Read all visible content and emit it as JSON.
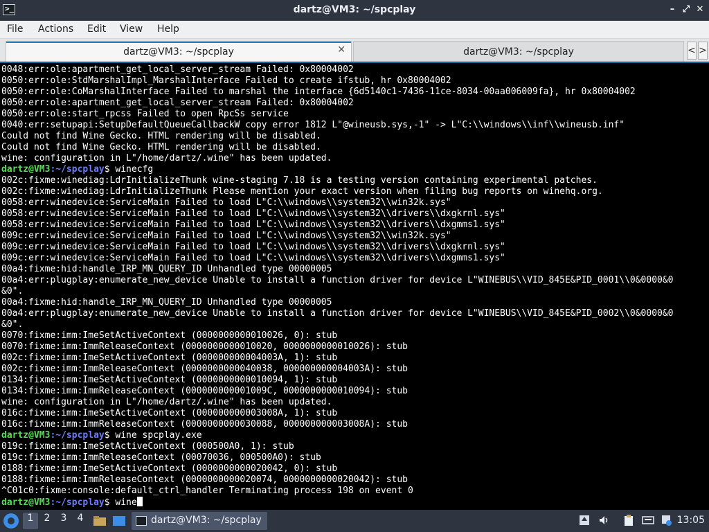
{
  "window": {
    "title": "dartz@VM3: ~/spcplay",
    "app_icon_glyph": ">_",
    "minimize_glyph": "–",
    "maximize_glyph": "⤢",
    "close_glyph": "✕"
  },
  "menu": [
    "File",
    "Actions",
    "Edit",
    "View",
    "Help"
  ],
  "tabs": [
    {
      "label": "dartz@VM3: ~/spcplay",
      "active": true,
      "close_glyph": "✕"
    },
    {
      "label": "dartz@VM3: ~/spcplay",
      "active": false
    }
  ],
  "tab_scroll": {
    "left": "<",
    "right": ">"
  },
  "terminal": {
    "colors": {
      "background": "#000000",
      "text": "#ffffff",
      "prompt_user": "#55dd55",
      "prompt_path": "#6b7cff"
    },
    "lines": [
      {
        "type": "out",
        "text": "0048:err:ole:apartment_get_local_server_stream Failed: 0x80004002"
      },
      {
        "type": "out",
        "text": "0050:err:ole:StdMarshalImpl_MarshalInterface Failed to create ifstub, hr 0x80004002"
      },
      {
        "type": "out",
        "text": "0050:err:ole:CoMarshalInterface Failed to marshal the interface {6d5140c1-7436-11ce-8034-00aa006009fa}, hr 0x80004002"
      },
      {
        "type": "out",
        "text": "0050:err:ole:apartment_get_local_server_stream Failed: 0x80004002"
      },
      {
        "type": "out",
        "text": "0050:err:ole:start_rpcss Failed to open RpcSs service"
      },
      {
        "type": "out",
        "text": "0040:err:setupapi:SetupDefaultQueueCallbackW copy error 1812 L\"@wineusb.sys,-1\" -> L\"C:\\\\windows\\\\inf\\\\wineusb.inf\""
      },
      {
        "type": "out",
        "text": "Could not find Wine Gecko. HTML rendering will be disabled."
      },
      {
        "type": "out",
        "text": "Could not find Wine Gecko. HTML rendering will be disabled."
      },
      {
        "type": "out",
        "text": "wine: configuration in L\"/home/dartz/.wine\" has been updated."
      },
      {
        "type": "prompt",
        "user": "dartz@VM3",
        "path": ":~/spcplay",
        "cmd": "$ winecfg"
      },
      {
        "type": "out",
        "text": "002c:fixme:winediag:LdrInitializeThunk wine-staging 7.18 is a testing version containing experimental patches."
      },
      {
        "type": "out",
        "text": "002c:fixme:winediag:LdrInitializeThunk Please mention your exact version when filing bug reports on winehq.org."
      },
      {
        "type": "out",
        "text": "0058:err:winedevice:ServiceMain Failed to load L\"C:\\\\windows\\\\system32\\\\win32k.sys\""
      },
      {
        "type": "out",
        "text": "0058:err:winedevice:ServiceMain Failed to load L\"C:\\\\windows\\\\system32\\\\drivers\\\\dxgkrnl.sys\""
      },
      {
        "type": "out",
        "text": "0058:err:winedevice:ServiceMain Failed to load L\"C:\\\\windows\\\\system32\\\\drivers\\\\dxgmms1.sys\""
      },
      {
        "type": "out",
        "text": "009c:err:winedevice:ServiceMain Failed to load L\"C:\\\\windows\\\\system32\\\\win32k.sys\""
      },
      {
        "type": "out",
        "text": "009c:err:winedevice:ServiceMain Failed to load L\"C:\\\\windows\\\\system32\\\\drivers\\\\dxgkrnl.sys\""
      },
      {
        "type": "out",
        "text": "009c:err:winedevice:ServiceMain Failed to load L\"C:\\\\windows\\\\system32\\\\drivers\\\\dxgmms1.sys\""
      },
      {
        "type": "out",
        "text": "00a4:fixme:hid:handle_IRP_MN_QUERY_ID Unhandled type 00000005"
      },
      {
        "type": "out",
        "text": "00a4:err:plugplay:enumerate_new_device Unable to install a function driver for device L\"WINEBUS\\\\VID_845E&PID_0001\\\\0&0000&0"
      },
      {
        "type": "out",
        "text": "&0\"."
      },
      {
        "type": "out",
        "text": "00a4:fixme:hid:handle_IRP_MN_QUERY_ID Unhandled type 00000005"
      },
      {
        "type": "out",
        "text": "00a4:err:plugplay:enumerate_new_device Unable to install a function driver for device L\"WINEBUS\\\\VID_845E&PID_0002\\\\0&0000&0"
      },
      {
        "type": "out",
        "text": "&0\"."
      },
      {
        "type": "out",
        "text": "0070:fixme:imm:ImeSetActiveContext (0000000000010026, 0): stub"
      },
      {
        "type": "out",
        "text": "0070:fixme:imm:ImmReleaseContext (0000000000010020, 0000000000010026): stub"
      },
      {
        "type": "out",
        "text": "002c:fixme:imm:ImeSetActiveContext (000000000004003A, 1): stub"
      },
      {
        "type": "out",
        "text": "002c:fixme:imm:ImmReleaseContext (0000000000040038, 000000000004003A): stub"
      },
      {
        "type": "out",
        "text": "0134:fixme:imm:ImeSetActiveContext (0000000000010094, 1): stub"
      },
      {
        "type": "out",
        "text": "0134:fixme:imm:ImmReleaseContext (000000000001009C, 0000000000010094): stub"
      },
      {
        "type": "out",
        "text": "wine: configuration in L\"/home/dartz/.wine\" has been updated."
      },
      {
        "type": "out",
        "text": "016c:fixme:imm:ImeSetActiveContext (000000000003008A, 1): stub"
      },
      {
        "type": "out",
        "text": "016c:fixme:imm:ImmReleaseContext (0000000000030088, 000000000003008A): stub"
      },
      {
        "type": "prompt",
        "user": "dartz@VM3",
        "path": ":~/spcplay",
        "cmd": "$ wine spcplay.exe"
      },
      {
        "type": "out",
        "text": "019c:fixme:imm:ImeSetActiveContext (000500A0, 1): stub"
      },
      {
        "type": "out",
        "text": "019c:fixme:imm:ImmReleaseContext (00070036, 000500A0): stub"
      },
      {
        "type": "out",
        "text": "0188:fixme:imm:ImeSetActiveContext (0000000000020042, 0): stub"
      },
      {
        "type": "out",
        "text": "0188:fixme:imm:ImmReleaseContext (0000000000020074, 0000000000020042): stub"
      },
      {
        "type": "out",
        "text": "^C01c0:fixme:console:default_ctrl_handler Terminating process 198 on event 0"
      },
      {
        "type": "prompt",
        "user": "dartz@VM3",
        "path": ":~/spcplay",
        "cmd": "$ wine",
        "cursor": true
      }
    ]
  },
  "taskbar": {
    "workspaces": [
      "1",
      "2",
      "3",
      "4"
    ],
    "active_workspace": "1",
    "task_label": "dartz@VM3: ~/spcplay",
    "tray_icons": [
      "upload-icon",
      "volume-icon",
      "clipboard-icon",
      "keyboard-icon",
      "network-icon"
    ],
    "clock": "13:05"
  }
}
